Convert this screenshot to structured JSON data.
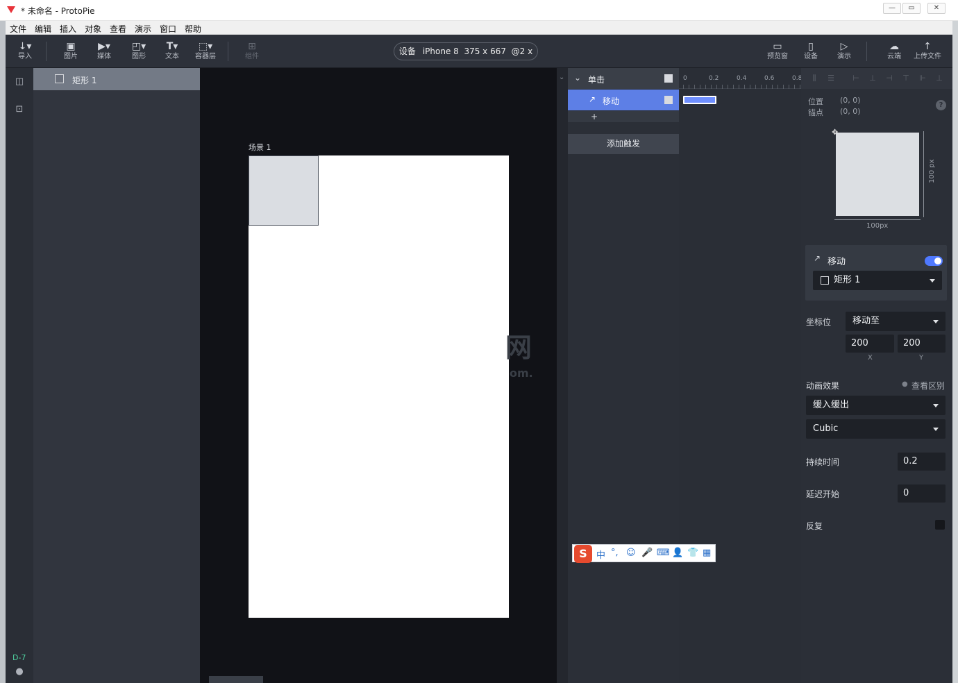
{
  "window": {
    "title": "* 未命名 - ProtoPie",
    "controls": [
      "—",
      "▭",
      "✕"
    ],
    "colors": {
      "accent": "#5d7fe6",
      "toggle": "#4f79ff",
      "canvas": "#111217",
      "panel": "#2b2f37"
    }
  },
  "menu": [
    "文件",
    "编辑",
    "插入",
    "对象",
    "查看",
    "演示",
    "窗口",
    "帮助"
  ],
  "toolbar": {
    "left": [
      {
        "icon": "import-icon",
        "label": "导入"
      },
      {
        "icon": "image-icon",
        "label": "图片"
      },
      {
        "icon": "media-icon",
        "label": "媒体"
      },
      {
        "icon": "shape-icon",
        "label": "图形"
      },
      {
        "icon": "text-icon",
        "label": "文本"
      },
      {
        "icon": "container-icon",
        "label": "容器层"
      },
      {
        "icon": "component-icon",
        "label": "组件"
      }
    ],
    "device": {
      "label": "设备",
      "model": "iPhone 8",
      "size": "375 x 667",
      "scale": "@2 x"
    },
    "right": [
      {
        "icon": "preview-window-icon",
        "label": "预览窗"
      },
      {
        "icon": "device-icon",
        "label": "设备"
      },
      {
        "icon": "play-icon",
        "label": "演示"
      },
      {
        "icon": "cloud-icon",
        "label": "云端"
      },
      {
        "icon": "upload-icon",
        "label": "上传文件"
      }
    ]
  },
  "sidebar": {
    "bottom_badge": "D-7"
  },
  "layers": [
    {
      "name": "矩形 1"
    }
  ],
  "canvas": {
    "scene_label": "场景 1",
    "watermark": "网",
    "watermark2": "om."
  },
  "triggers": {
    "trigger": {
      "label": "单击"
    },
    "response": {
      "label": "移动"
    },
    "add_response": "+",
    "add_trigger": "添加触发"
  },
  "timeline": {
    "ticks": [
      "0",
      "0.2",
      "0.4",
      "0.6",
      "0.8"
    ]
  },
  "properties": {
    "position_label": "位置",
    "position_value": "(0, 0)",
    "anchor_label": "锚点",
    "anchor_value": "(0, 0)",
    "help": "?",
    "size_w": "100px",
    "size_h": "100 px",
    "response_title": "移动",
    "response_enabled": true,
    "target_layer": "矩形 1",
    "coord_label": "坐标位",
    "coord_mode": "移动至",
    "x_value": "200",
    "y_value": "200",
    "x_label": "X",
    "y_label": "Y",
    "anim_label": "动画效果",
    "view_diff": "查看区别",
    "easing": "缓入缓出",
    "curve": "Cubic",
    "duration_label": "持续时间",
    "duration_value": "0.2",
    "delay_label": "延迟开始",
    "delay_value": "0",
    "repeat_label": "反复",
    "repeat_checked": false
  },
  "ime": {
    "logo": "S",
    "glyphs": [
      "中",
      "°,",
      "☺",
      "🎤",
      "⌨",
      "👤",
      "👕",
      "▦"
    ]
  }
}
